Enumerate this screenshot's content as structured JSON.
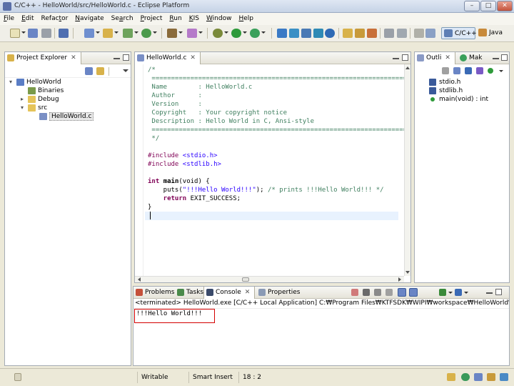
{
  "window": {
    "title": "C/C++ - HelloWorld/src/HelloWorld.c - Eclipse Platform"
  },
  "menu": [
    {
      "label": "File",
      "key": "F"
    },
    {
      "label": "Edit",
      "key": "E"
    },
    {
      "label": "Refactor",
      "key": "t"
    },
    {
      "label": "Navigate",
      "key": "N"
    },
    {
      "label": "Search",
      "key": "a"
    },
    {
      "label": "Project",
      "key": "P"
    },
    {
      "label": "Run",
      "key": "R"
    },
    {
      "label": "KIS",
      "key": "K"
    },
    {
      "label": "Window",
      "key": "W"
    },
    {
      "label": "Help",
      "key": "H"
    }
  ],
  "perspectives": {
    "active": "C/C++",
    "other": "Java"
  },
  "project_explorer": {
    "tab_label": "Project Explorer",
    "tree": [
      {
        "label": "HelloWorld",
        "icon": "project-icon",
        "level": 0
      },
      {
        "label": "Binaries",
        "icon": "binaries-icon",
        "level": 1
      },
      {
        "label": "Debug",
        "icon": "folder-icon",
        "level": 1
      },
      {
        "label": "src",
        "icon": "source-folder-icon",
        "level": 1
      },
      {
        "label": "HelloWorld.c",
        "icon": "c-file-icon",
        "level": 2,
        "selected": true
      }
    ]
  },
  "editor": {
    "tab_label": "HelloWorld.c",
    "lines": [
      "/*",
      " ============================================================================",
      " Name        : HelloWorld.c",
      " Author      :",
      " Version     :",
      " Copyright   : Your copyright notice",
      " Description : Hello World in C, Ansi-style",
      " ============================================================================",
      " */",
      "",
      "#include <stdio.h>",
      "#include <stdlib.h>",
      "",
      "int main(void) {",
      "    puts(\"!!!Hello World!!!\"); /* prints !!!Hello World!!! */",
      "    return EXIT_SUCCESS;",
      "}",
      ""
    ],
    "code": {
      "include1_kw": "#include",
      "include1_file": "<stdio.h>",
      "include2_kw": "#include",
      "include2_file": "<stdlib.h>",
      "main_kw": "int",
      "main_name": "main",
      "main_rest": "(void) {",
      "puts_fn": "    puts(",
      "puts_str": "\"!!!Hello World!!!\"",
      "puts_end": ");",
      "puts_comment": " /* prints !!!Hello World!!! */",
      "return_kw": "    return",
      "return_rest": " EXIT_SUCCESS;",
      "close_brace": "}"
    }
  },
  "outline": {
    "tab_label": "Outli",
    "second_tab_label": "Mak",
    "items": [
      {
        "label": "stdio.h",
        "icon": "include-icon"
      },
      {
        "label": "stdlib.h",
        "icon": "include-icon"
      },
      {
        "label": "main(void) : int",
        "icon": "function-icon"
      }
    ]
  },
  "bottom_panel": {
    "tabs": [
      {
        "label": "Problems",
        "icon": "problems-icon"
      },
      {
        "label": "Tasks",
        "icon": "tasks-icon"
      },
      {
        "label": "Console",
        "icon": "console-icon",
        "active": true
      },
      {
        "label": "Properties",
        "icon": "properties-icon"
      }
    ],
    "console_header": "<terminated> HelloWorld.exe [C/C++ Local Application] C:₩Program Files₩KTFSDK₩WIPI₩workspace₩HelloWorld₩Debug₩HelloWorld.exe",
    "console_output": "!!!Hello World!!!"
  },
  "status_bar": {
    "mode": "Writable",
    "insert": "Smart Insert",
    "position": "18 : 2"
  },
  "colors": {
    "accent": "#5a6fa8",
    "highlight_box": "#d40000",
    "comment": "#3f7f5f",
    "keyword": "#7f0055",
    "string": "#2a00ff"
  }
}
